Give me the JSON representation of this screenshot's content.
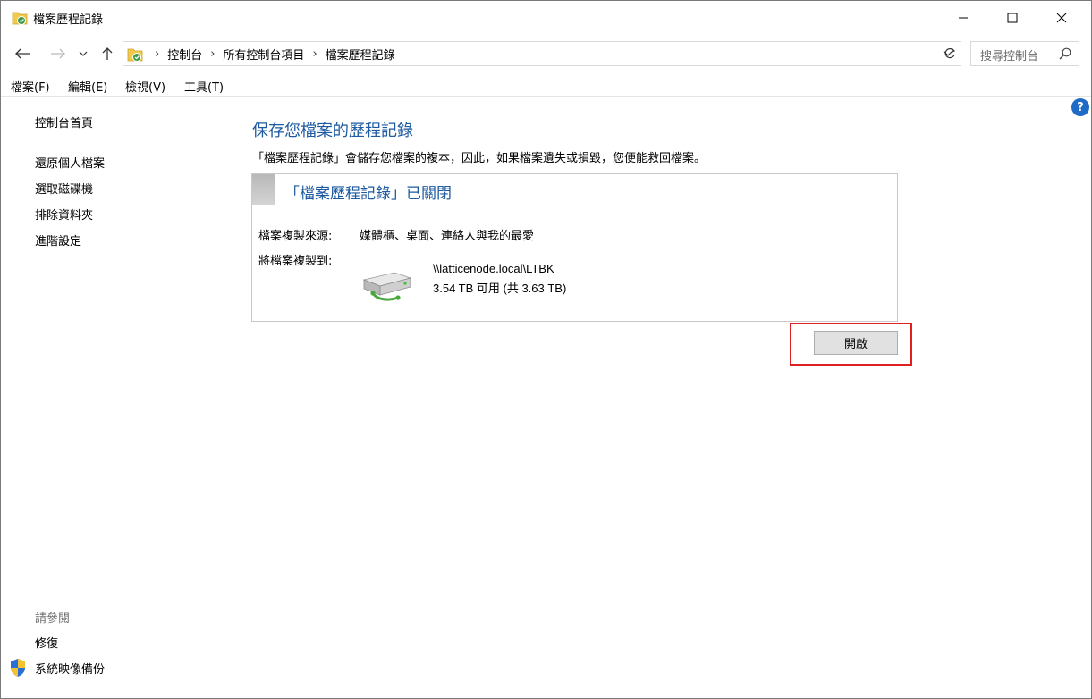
{
  "window": {
    "title": "檔案歷程記錄"
  },
  "titlebar": {
    "minimize_icon": "minimize-icon",
    "maximize_icon": "maximize-icon",
    "close_icon": "close-icon"
  },
  "nav": {
    "back_icon": "arrow-left-icon",
    "forward_icon": "arrow-right-icon",
    "recent_icon": "chevron-down-icon",
    "up_icon": "arrow-up-icon",
    "breadcrumbs": [
      "控制台",
      "所有控制台項目",
      "檔案歷程記錄"
    ],
    "search_placeholder": "搜尋控制台"
  },
  "menu": [
    {
      "label": "檔案(F)"
    },
    {
      "label": "編輯(E)"
    },
    {
      "label": "檢視(V)"
    },
    {
      "label": "工具(T)"
    }
  ],
  "sidebar": {
    "home": "控制台首頁",
    "links": [
      "還原個人檔案",
      "選取磁碟機",
      "排除資料夾",
      "進階設定"
    ],
    "see_also_title": "請參閱",
    "see_also": [
      "修復",
      "系統映像備份"
    ]
  },
  "main": {
    "heading": "保存您檔案的歷程記錄",
    "description": "「檔案歷程記錄」會儲存您檔案的複本，因此，如果檔案遺失或損毀，您便能救回檔案。",
    "status": "「檔案歷程記錄」已關閉",
    "source_label": "檔案複製來源:",
    "source_value": "媒體櫃、桌面、連絡人與我的最愛",
    "dest_label": "將檔案複製到:",
    "dest_path": "\\\\latticenode.local\\LTBK",
    "dest_space": "3.54 TB 可用 (共 3.63 TB)",
    "open_button": "開啟"
  },
  "colors": {
    "link_blue": "#1e5aa0",
    "highlight": "#e02020",
    "help_blue": "#1e6bc6"
  }
}
